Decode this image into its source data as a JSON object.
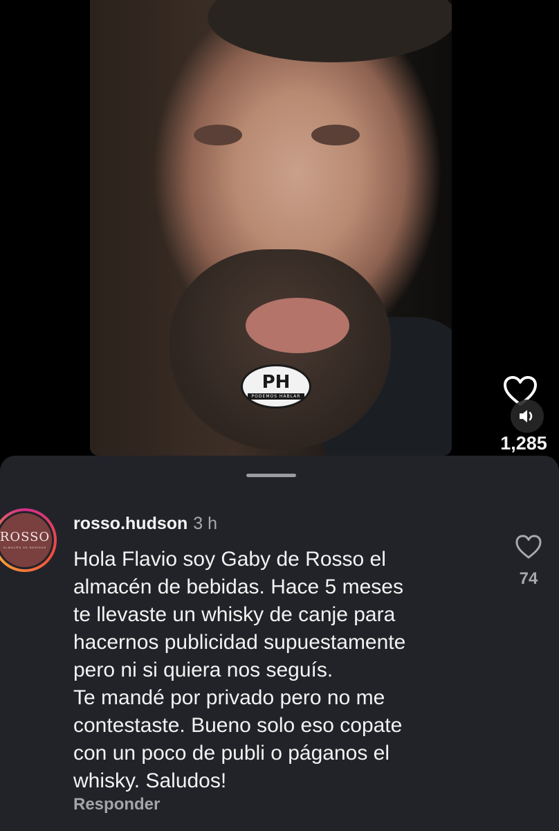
{
  "video": {
    "channel_logo": {
      "main": "PH",
      "sub": "PODEMOS HABLAR"
    },
    "like_icon": "heart-outline-icon",
    "sound_icon": "speaker-icon",
    "likes": "1,285"
  },
  "comment": {
    "avatar_logo": {
      "main": "ROSSO",
      "sub": "ALMACÉN DE BEBIDAS"
    },
    "username": "rosso.hudson",
    "time": "3 h",
    "text": "Hola Flavio soy Gaby de Rosso el\nalmacén de bebidas. Hace 5 meses\nte llevaste un whisky de canje para\nhacernos publicidad supuestamente\npero ni si quiera nos seguís.\nTe mandé por privado pero no me\ncontestaste. Bueno solo eso copate\ncon un poco de publi o páganos el\nwhisky. Saludos!",
    "reply_label": "Responder",
    "like_icon": "heart-outline-icon",
    "likes": "74"
  },
  "colors": {
    "sheet_background": "#212328",
    "primary_text": "#f3f3f3",
    "secondary_text": "#a8a9ad",
    "avatar_background": "#7a3f3f"
  }
}
